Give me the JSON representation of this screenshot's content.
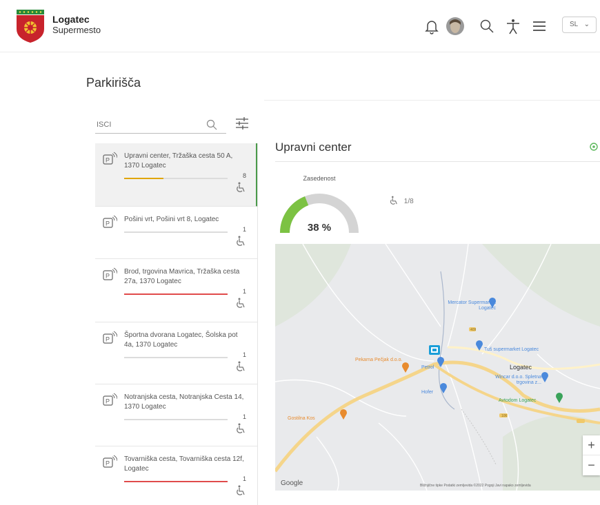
{
  "header": {
    "title": "Logatec",
    "subtitle": "Supermesto",
    "language": "SL",
    "icons": [
      "bell-icon",
      "avatar",
      "search-icon",
      "accessibility-icon",
      "menu-icon"
    ]
  },
  "page": {
    "title": "Parkirišča"
  },
  "search": {
    "placeholder": "ISCI"
  },
  "list": [
    {
      "title": "Upravni center, Tržaška cesta 50 A, 1370 Logatec",
      "count": "8",
      "fill": 0.38,
      "color": "#e0a500",
      "active": true
    },
    {
      "title": "Pošini vrt, Pošini vrt 8, Logatec",
      "count": "1",
      "fill": 0.0,
      "color": "#dcdcdc",
      "active": false
    },
    {
      "title": "Brod, trgovina Mavrica, Tržaška cesta 27a, 1370 Logatec",
      "count": "1",
      "fill": 1.0,
      "color": "#e04a4a",
      "active": false
    },
    {
      "title": "Športna dvorana Logatec, Šolska pot 4a, 1370 Logatec",
      "count": "1",
      "fill": 0.0,
      "color": "#dcdcdc",
      "active": false
    },
    {
      "title": "Notranjska cesta, Notranjska Cesta 14, 1370 Logatec",
      "count": "1",
      "fill": 0.0,
      "color": "#dcdcdc",
      "active": false
    },
    {
      "title": "Tovarniška cesta, Tovarniška cesta 12f, Logatec",
      "count": "1",
      "fill": 1.0,
      "color": "#e04a4a",
      "active": false
    }
  ],
  "detail": {
    "title": "Upravni center",
    "gauge_label": "Zasedenost",
    "occupancy_percent": 38,
    "occupancy_text": "38 %",
    "gauge_color": "#7cc243",
    "accessible_text": "1/8"
  },
  "map": {
    "labels": {
      "mercator": "Mercator Supermarket Logatec",
      "tus": "Tuš supermarket Logatec",
      "logatec": "Logatec",
      "pekarna": "Pekarna Pečjak d.o.o.",
      "petrol": "Petrol",
      "wincar": "Wincar d.o.o. Spletna trgovina z...",
      "hofer": "Hofer",
      "avtodom": "Avtodom Logatec",
      "gostilna": "Gostilna Kos",
      "road_409": "409",
      "road_106": "106"
    },
    "zoom_in": "+",
    "zoom_out": "−",
    "google": "Google",
    "attribution": "Bližnjične tipke   Podatki zemljevida ©2022   Pogoji   Javi napako zemljevida"
  }
}
